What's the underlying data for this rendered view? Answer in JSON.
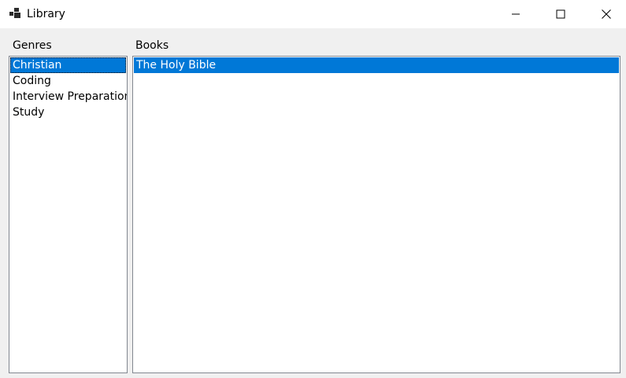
{
  "window": {
    "title": "Library",
    "icon": "app-icon"
  },
  "caption_buttons": {
    "minimize_icon": "minimize-icon",
    "maximize_icon": "maximize-icon",
    "close_icon": "close-icon"
  },
  "genres": {
    "label": "Genres",
    "items": [
      "Christian",
      "Coding",
      "Interview Preparation",
      "Study"
    ],
    "selected": "Christian"
  },
  "books": {
    "label": "Books",
    "items": [
      "The Holy Bible"
    ],
    "selected": "The Holy Bible"
  },
  "colors": {
    "selection": "#0078d7",
    "window_bg": "#f0f0f0"
  }
}
